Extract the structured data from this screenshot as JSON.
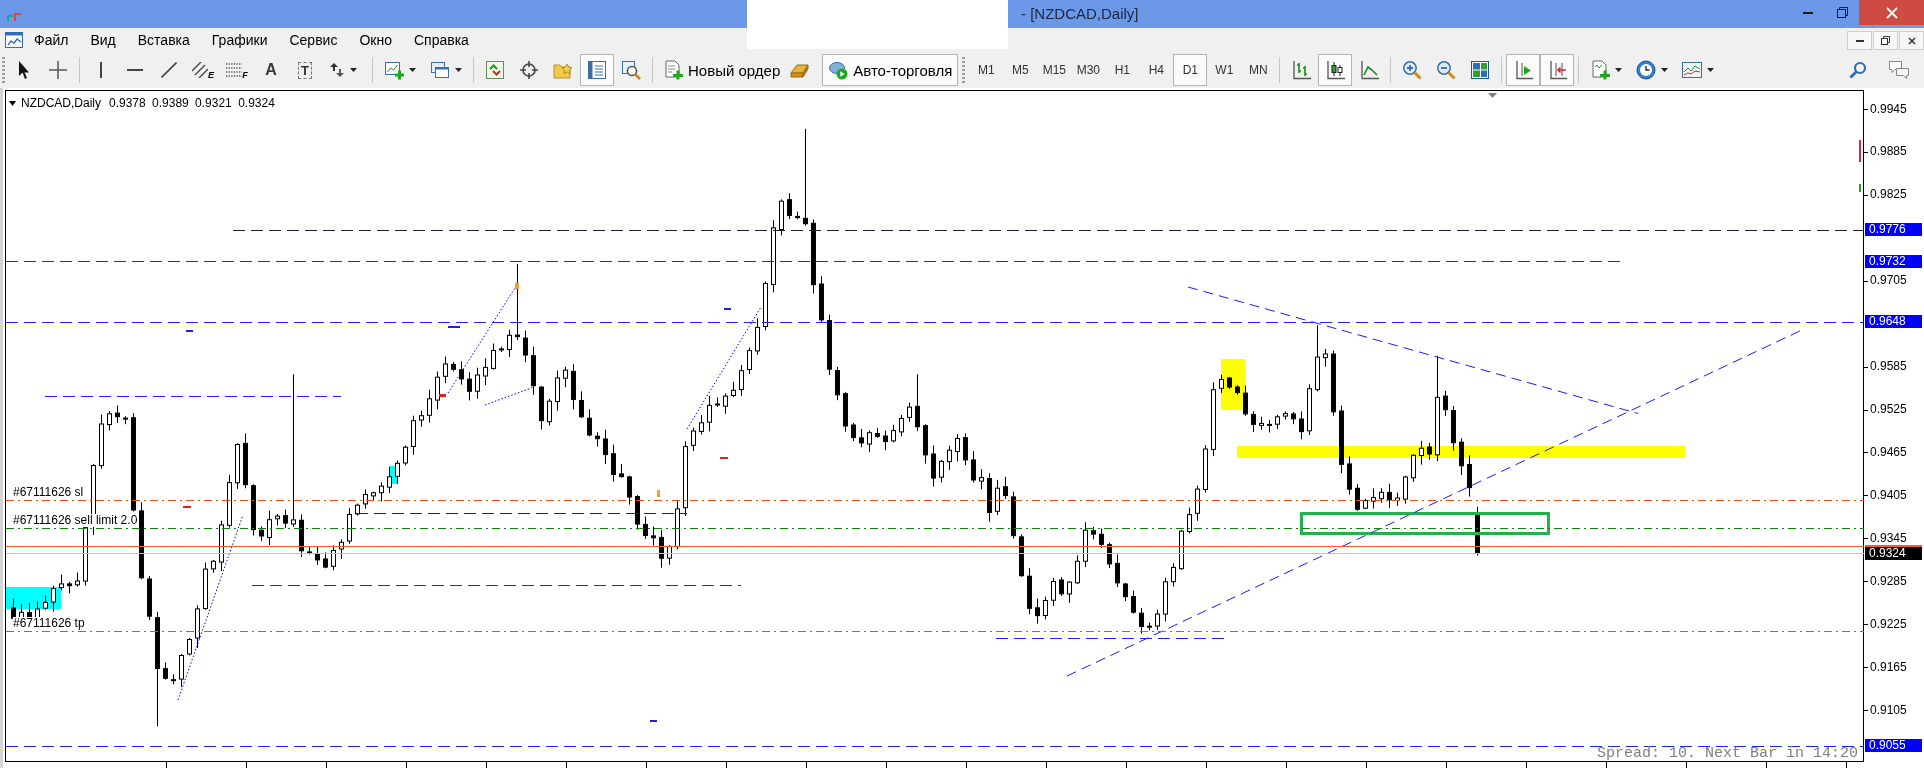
{
  "window": {
    "title": "- [NZDCAD,Daily]"
  },
  "menu": [
    "Файл",
    "Вид",
    "Вставка",
    "Графики",
    "Сервис",
    "Окно",
    "Справка"
  ],
  "toolbar": {
    "tool_letters": [
      "E",
      "F",
      "A",
      "T"
    ],
    "panels": [
      {
        "pressed": false
      },
      {
        "pressed": false
      },
      {
        "pressed": false
      },
      {
        "pressed": true
      },
      {
        "pressed": false
      }
    ],
    "new_order": "Новый ордер",
    "auto_trading": {
      "label": "Авто-торговля",
      "pressed": true
    },
    "timeframes": [
      {
        "label": "M1",
        "selected": false
      },
      {
        "label": "M5",
        "selected": false
      },
      {
        "label": "M15",
        "selected": false
      },
      {
        "label": "M30",
        "selected": false
      },
      {
        "label": "H1",
        "selected": false
      },
      {
        "label": "H4",
        "selected": false
      },
      {
        "label": "D1",
        "selected": true
      },
      {
        "label": "W1",
        "selected": false
      },
      {
        "label": "MN",
        "selected": false
      }
    ],
    "chart_types": [
      {
        "selected": false
      },
      {
        "selected": true
      },
      {
        "selected": false
      }
    ],
    "chart_modes": [
      {
        "pressed": true
      },
      {
        "pressed": true
      }
    ]
  },
  "chart": {
    "symbol": "NZDCAD,Daily",
    "ohlc": "0.9378 0.9389 0.9321 0.9324",
    "order_labels": [
      "#67111626 sl",
      "#67111626 sell limit 2.0",
      "#67111626 tp"
    ],
    "price_scale": [
      "0.9945",
      "0.9885",
      "0.9825",
      "0.9705",
      "0.9585",
      "0.9525",
      "0.9465",
      "0.9405",
      "0.9345",
      "0.9285",
      "0.9225",
      "0.9165",
      "0.9105"
    ],
    "level_tags": [
      {
        "text": "0.9776",
        "color": "#0000ff"
      },
      {
        "text": "0.9732",
        "color": "#0000ff"
      },
      {
        "text": "0.9648",
        "color": "#0000ff"
      },
      {
        "text": "0.9324",
        "color": "#000000"
      },
      {
        "text": "0.9055",
        "color": "#0000ff"
      }
    ],
    "status": "Spread: 10. Next Bar in 14:20"
  }
}
